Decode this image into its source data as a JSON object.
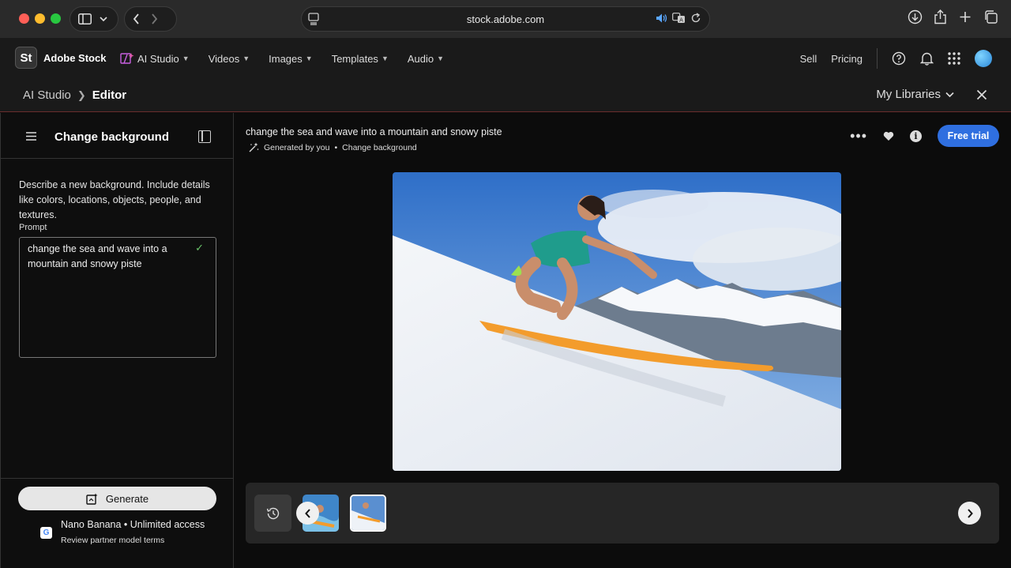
{
  "browser": {
    "url": "stock.adobe.com"
  },
  "appbar": {
    "brand": "Adobe Stock",
    "logo_text": "St",
    "menu": [
      {
        "label": "AI Studio"
      },
      {
        "label": "Videos"
      },
      {
        "label": "Images"
      },
      {
        "label": "Templates"
      },
      {
        "label": "Audio"
      }
    ],
    "sell": "Sell",
    "pricing": "Pricing"
  },
  "breadcrumb": {
    "parent": "AI Studio",
    "current": "Editor",
    "libraries": "My Libraries"
  },
  "panel": {
    "title": "Change background",
    "description": "Describe a new background. Include details like colors, locations, objects, people, and textures.",
    "prompt_label": "Prompt",
    "prompt_value": "change the sea and wave into a mountain and snowy piste",
    "generate_label": "Generate",
    "model": "Nano Banana • Unlimited access",
    "terms": "Review partner model terms"
  },
  "main": {
    "title": "change the sea and wave into a mountain and snowy piste",
    "generated_by": "Generated by you",
    "operation": "Change background",
    "free_trial": "Free trial"
  },
  "colors": {
    "accent": "#2f6fe0",
    "check": "#6ac46a"
  }
}
